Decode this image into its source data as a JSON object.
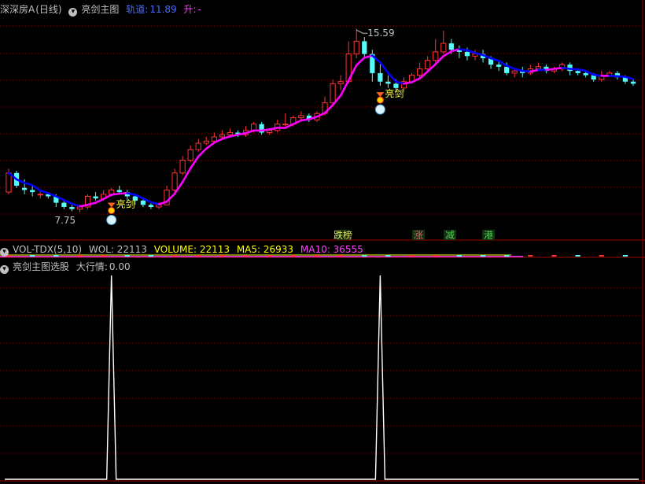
{
  "main_header": {
    "stock_name": "深深房A",
    "period": "(日线)",
    "indicator": "亮剑主图",
    "track_label": "轨道:",
    "track_value": "11.89",
    "rise_label": "升:",
    "rise_value": "-"
  },
  "volume_header": {
    "title": "VOL-TDX(5,10)",
    "wol": "WOL: 22113",
    "volume": "VOLUME: 22113",
    "ma5": "MA5: 26933",
    "ma10": "MA10: 36555"
  },
  "signal_header": {
    "title": "亮剑主图选股",
    "market_label": "大行情:",
    "market_value": "0.00"
  },
  "colors": {
    "up": "#ff3232",
    "down": "#54fcfc",
    "trend_up": "#ff00ff",
    "trend_down": "#0000ff",
    "grid": "#8b0000",
    "panel_border": "#a00000",
    "signal_line": "#ffffff"
  },
  "icons": [
    "circle-dropdown-icon",
    "sword-signal-icon",
    "ball-marker-icon"
  ],
  "chart_data": [
    {
      "type": "candlestick",
      "title": "深深房A (日线)",
      "high_annotation": "15.59",
      "low_annotation": "7.75",
      "signal_labels": [
        "亮剑",
        "亮剑"
      ],
      "bottom_tags": [
        "涨",
        "减",
        "港"
      ],
      "bottom_tag_cut": "跌榜",
      "ohlc": [
        [
          8.7,
          9.6,
          9.8,
          8.6
        ],
        [
          9.6,
          9.0,
          9.7,
          8.9
        ],
        [
          8.9,
          8.8,
          9.3,
          8.6
        ],
        [
          8.8,
          8.7,
          9.0,
          8.5
        ],
        [
          8.6,
          8.6,
          8.8,
          8.4
        ],
        [
          8.6,
          8.5,
          8.7,
          8.4
        ],
        [
          8.5,
          8.2,
          8.6,
          8.0
        ],
        [
          8.2,
          8.0,
          8.3,
          7.9
        ],
        [
          8.0,
          7.9,
          8.1,
          7.8
        ],
        [
          7.9,
          8.0,
          8.1,
          7.75
        ],
        [
          8.0,
          8.5,
          8.6,
          7.9
        ],
        [
          8.5,
          8.4,
          8.7,
          8.3
        ],
        [
          8.4,
          8.6,
          8.8,
          8.3
        ],
        [
          8.6,
          8.8,
          8.9,
          8.5
        ],
        [
          8.8,
          8.7,
          9.0,
          8.6
        ],
        [
          8.7,
          8.5,
          8.8,
          8.3
        ],
        [
          8.5,
          8.3,
          8.6,
          8.1
        ],
        [
          8.3,
          8.1,
          8.4,
          8.0
        ],
        [
          8.1,
          8.0,
          8.2,
          7.9
        ],
        [
          8.0,
          8.1,
          8.2,
          7.9
        ],
        [
          8.1,
          8.8,
          9.0,
          8.1
        ],
        [
          8.8,
          9.6,
          9.8,
          8.7
        ],
        [
          9.6,
          10.2,
          10.4,
          9.5
        ],
        [
          10.2,
          10.7,
          10.9,
          10.1
        ],
        [
          10.7,
          11.0,
          11.2,
          10.6
        ],
        [
          11.0,
          11.1,
          11.3,
          10.9
        ],
        [
          11.1,
          11.3,
          11.5,
          11.0
        ],
        [
          11.3,
          11.4,
          11.6,
          11.2
        ],
        [
          11.4,
          11.5,
          11.7,
          11.3
        ],
        [
          11.5,
          11.4,
          11.6,
          11.3
        ],
        [
          11.4,
          11.6,
          11.8,
          11.3
        ],
        [
          11.6,
          11.9,
          12.0,
          11.5
        ],
        [
          11.9,
          11.5,
          12.0,
          11.4
        ],
        [
          11.5,
          11.6,
          11.7,
          11.4
        ],
        [
          11.6,
          11.9,
          12.1,
          11.5
        ],
        [
          11.9,
          11.9,
          12.4,
          11.8
        ],
        [
          11.9,
          12.2,
          12.3,
          11.8
        ],
        [
          12.2,
          12.3,
          12.5,
          12.1
        ],
        [
          12.3,
          12.1,
          12.4,
          12.0
        ],
        [
          12.1,
          12.4,
          12.5,
          12.0
        ],
        [
          12.4,
          12.9,
          13.2,
          12.3
        ],
        [
          12.9,
          13.8,
          14.0,
          12.8
        ],
        [
          13.8,
          13.9,
          14.2,
          13.5
        ],
        [
          13.9,
          15.2,
          15.8,
          13.8
        ],
        [
          15.2,
          15.8,
          16.4,
          15.0
        ],
        [
          15.8,
          15.2,
          16.0,
          15.0
        ],
        [
          15.2,
          14.3,
          15.4,
          13.9
        ],
        [
          14.3,
          13.9,
          14.8,
          13.7
        ],
        [
          13.9,
          13.8,
          14.2,
          13.6
        ],
        [
          13.8,
          13.6,
          14.0,
          13.4
        ],
        [
          13.6,
          13.9,
          14.1,
          13.4
        ],
        [
          13.9,
          14.2,
          14.3,
          13.8
        ],
        [
          14.2,
          14.5,
          14.8,
          14.1
        ],
        [
          14.5,
          14.9,
          15.1,
          14.4
        ],
        [
          14.9,
          15.3,
          15.9,
          14.8
        ],
        [
          15.3,
          15.7,
          16.3,
          15.2
        ],
        [
          15.7,
          15.4,
          15.9,
          15.2
        ],
        [
          15.4,
          15.3,
          15.6,
          15.0
        ],
        [
          15.3,
          15.1,
          15.5,
          14.9
        ],
        [
          15.1,
          15.2,
          15.4,
          14.9
        ],
        [
          15.2,
          15.0,
          15.4,
          14.8
        ],
        [
          15.0,
          14.7,
          15.1,
          14.5
        ],
        [
          14.7,
          14.6,
          14.9,
          14.4
        ],
        [
          14.6,
          14.3,
          14.8,
          14.2
        ],
        [
          14.3,
          14.4,
          14.5,
          14.1
        ],
        [
          14.4,
          14.3,
          14.6,
          14.1
        ],
        [
          14.3,
          14.5,
          14.7,
          14.2
        ],
        [
          14.5,
          14.6,
          14.8,
          14.4
        ],
        [
          14.6,
          14.4,
          14.7,
          14.3
        ],
        [
          14.4,
          14.5,
          14.6,
          14.3
        ],
        [
          14.5,
          14.7,
          14.8,
          14.4
        ],
        [
          14.7,
          14.4,
          14.8,
          14.2
        ],
        [
          14.4,
          14.3,
          14.5,
          14.2
        ],
        [
          14.3,
          14.2,
          14.4,
          14.1
        ],
        [
          14.2,
          14.0,
          14.3,
          13.9
        ],
        [
          14.0,
          14.2,
          14.4,
          13.9
        ],
        [
          14.2,
          14.3,
          14.4,
          14.1
        ],
        [
          14.3,
          14.1,
          14.4,
          14.0
        ],
        [
          14.1,
          13.9,
          14.2,
          13.8
        ],
        [
          13.9,
          13.8,
          14.0,
          13.7
        ]
      ],
      "volume_ma_note": "MA5: 26933, MA10: 36555",
      "signal_spikes": [
        13,
        47
      ]
    }
  ]
}
